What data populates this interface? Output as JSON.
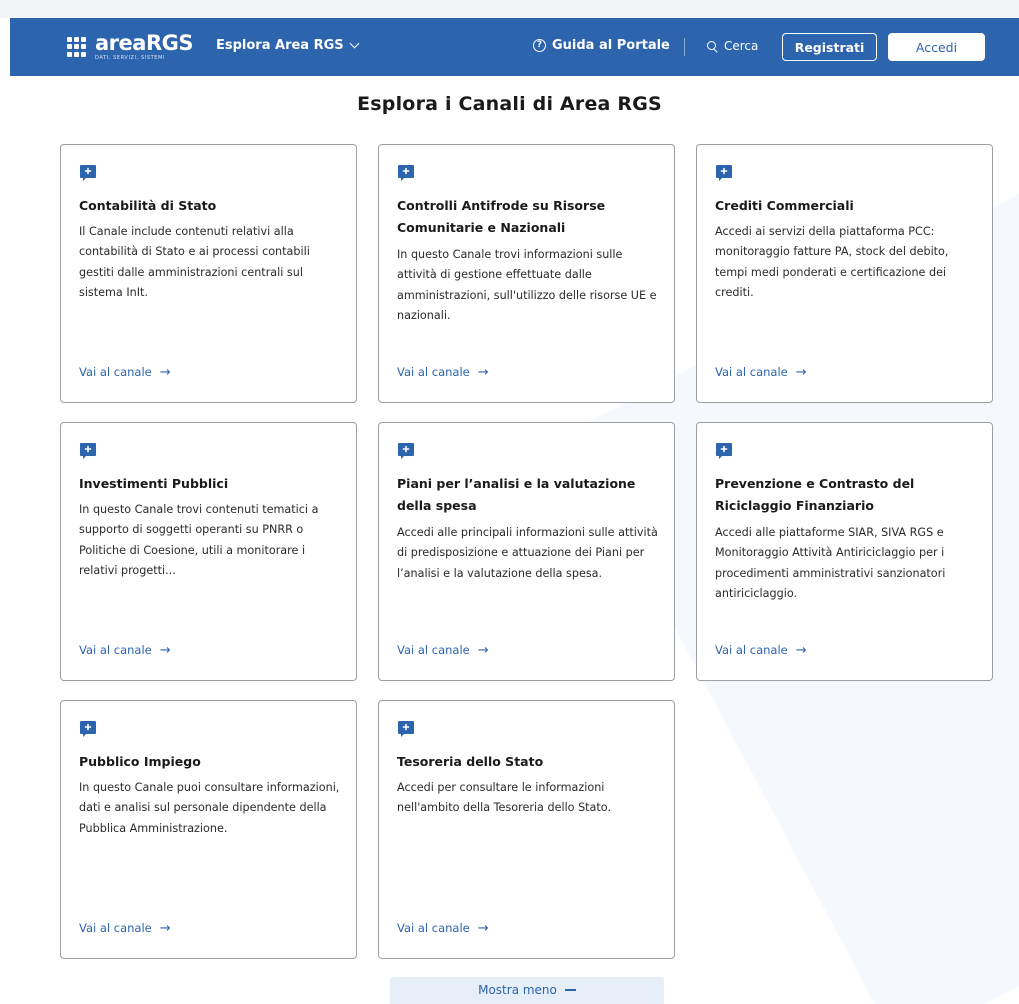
{
  "header": {
    "logo_main": "areaRGS",
    "logo_sub": "DATI, SERVIZI, SISTEMI",
    "explore_label": "Esplora Area RGS",
    "guide_label": "Guida al Portale",
    "search_label": "Cerca",
    "register_label": "Registrati",
    "login_label": "Accedi"
  },
  "page": {
    "title": "Esplora i Canali di Area RGS",
    "show_less_label": "Mostra meno"
  },
  "colors": {
    "brand_blue": "#2d64ae",
    "card_border": "#9aa0a6"
  },
  "cards": [
    {
      "title": "Contabilità di Stato",
      "description": "Il Canale include contenuti relativi alla contabilità di Stato e ai processi contabili gestiti dalle amministrazioni centrali sul sistema InIt.",
      "link_label": "Vai al canale",
      "icon": "chat-plus-icon"
    },
    {
      "title": "Controlli Antifrode su Risorse Comunitarie e Nazionali",
      "description": "In questo Canale trovi informazioni sulle attività di gestione effettuate dalle amministrazioni, sull'utilizzo delle risorse UE e nazionali.",
      "link_label": "Vai al canale",
      "icon": "chat-plus-icon"
    },
    {
      "title": "Crediti Commerciali",
      "description": "Accedi ai servizi della piattaforma PCC: monitoraggio fatture PA, stock del debito, tempi medi ponderati e certificazione dei crediti.",
      "link_label": "Vai al canale",
      "icon": "chat-plus-icon"
    },
    {
      "title": "Investimenti Pubblici",
      "description": "In questo Canale trovi contenuti tematici a supporto di soggetti operanti su PNRR o Politiche di Coesione, utili a monitorare i relativi progetti...",
      "link_label": "Vai al canale",
      "icon": "chat-plus-icon"
    },
    {
      "title": "Piani per l’analisi e la valutazione della spesa",
      "description": "Accedi alle principali informazioni sulle attività di predisposizione e attuazione dei Piani per l’analisi e la valutazione della spesa.",
      "link_label": "Vai al canale",
      "icon": "chat-plus-icon"
    },
    {
      "title": "Prevenzione e Contrasto del Riciclaggio Finanziario",
      "description": "Accedi alle piattaforme SIAR, SIVA RGS e Monitoraggio Attività Antiriciclaggio per i procedimenti amministrativi sanzionatori antiriciclaggio.",
      "link_label": "Vai al canale",
      "icon": "chat-plus-icon"
    },
    {
      "title": "Pubblico Impiego",
      "description": "In questo Canale puoi consultare informazioni, dati e analisi sul personale dipendente della Pubblica Amministrazione.",
      "link_label": "Vai al canale",
      "icon": "chat-plus-icon"
    },
    {
      "title": "Tesoreria dello Stato",
      "description": "Accedi per consultare le informazioni nell'ambito della Tesoreria dello Stato.",
      "link_label": "Vai al canale",
      "icon": "chat-plus-icon"
    }
  ]
}
